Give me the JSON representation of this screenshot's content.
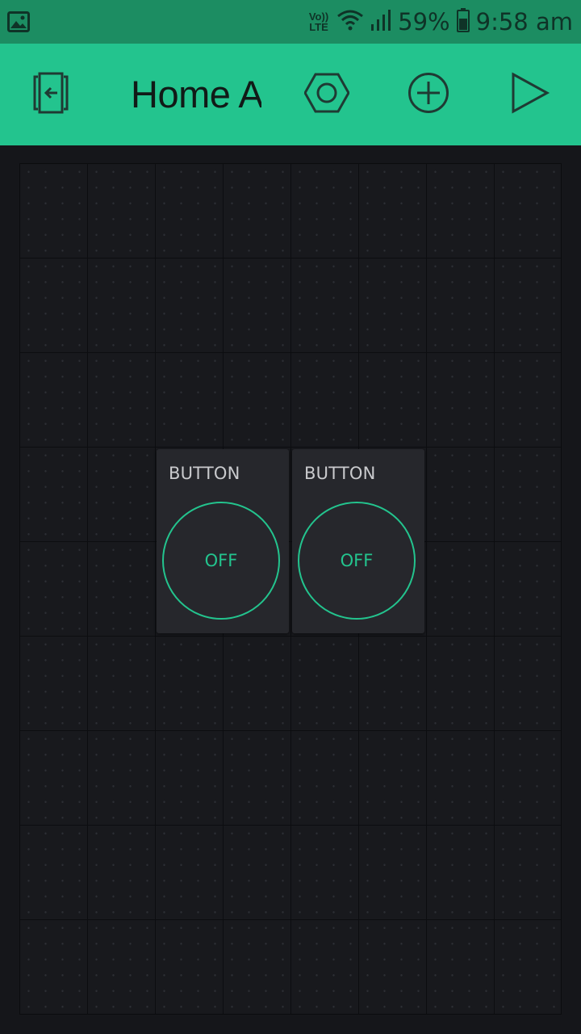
{
  "status_bar": {
    "network": "Vo)) LTE",
    "network_line1": "Vo))",
    "network_line2": "LTE",
    "battery_percent": "59%",
    "time": "9:58 am",
    "icons": [
      "gallery-icon",
      "wifi-icon",
      "signal-icon",
      "battery-icon"
    ]
  },
  "app_bar": {
    "title": "Home A",
    "icons": [
      "exit-icon",
      "settings-hexagon-icon",
      "add-circle-icon",
      "play-icon"
    ],
    "colors": {
      "background": "#23c48e",
      "icon": "#1f3a33"
    }
  },
  "widgets": [
    {
      "label": "BUTTON",
      "state": "OFF"
    },
    {
      "label": "BUTTON",
      "state": "OFF"
    }
  ],
  "colors": {
    "accent": "#23c48e",
    "canvas": "#15161a",
    "widget_bg": "#26272c",
    "status_bar": "#1c8d62"
  }
}
